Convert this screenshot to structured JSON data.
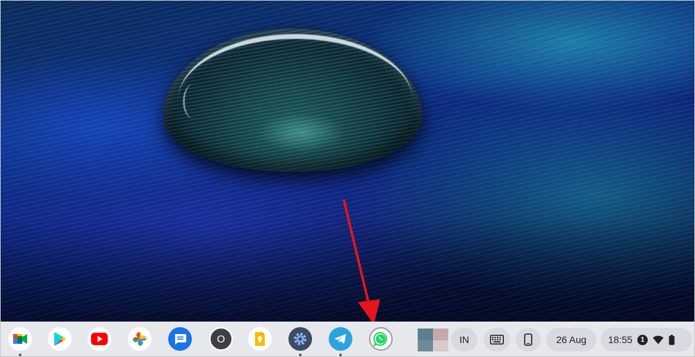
{
  "shelf": {
    "apps": [
      {
        "id": "meet",
        "icon": "google-meet-icon"
      },
      {
        "id": "play",
        "icon": "play-store-icon"
      },
      {
        "id": "youtube",
        "icon": "youtube-icon"
      },
      {
        "id": "photos",
        "icon": "google-photos-icon"
      },
      {
        "id": "messages",
        "icon": "messages-icon"
      },
      {
        "id": "o",
        "icon": "o-app-icon",
        "label": "O"
      },
      {
        "id": "keep",
        "icon": "google-keep-icon"
      },
      {
        "id": "settings",
        "icon": "settings-gear-icon"
      },
      {
        "id": "telegram",
        "icon": "telegram-icon"
      },
      {
        "id": "whatsapp",
        "icon": "whatsapp-icon"
      }
    ],
    "ime_label": "IN",
    "keyboard_icon": "keyboard-icon",
    "phone_icon": "phone-hub-icon",
    "date": "26 Aug",
    "time": "18:55",
    "notification_count": "1",
    "wifi_icon": "wifi-icon",
    "battery_icon": "battery-icon"
  },
  "colors": {
    "shelf_bg": "#e6e8ec",
    "pill_bg": "#d7dae0",
    "arrow": "#e8141b"
  }
}
